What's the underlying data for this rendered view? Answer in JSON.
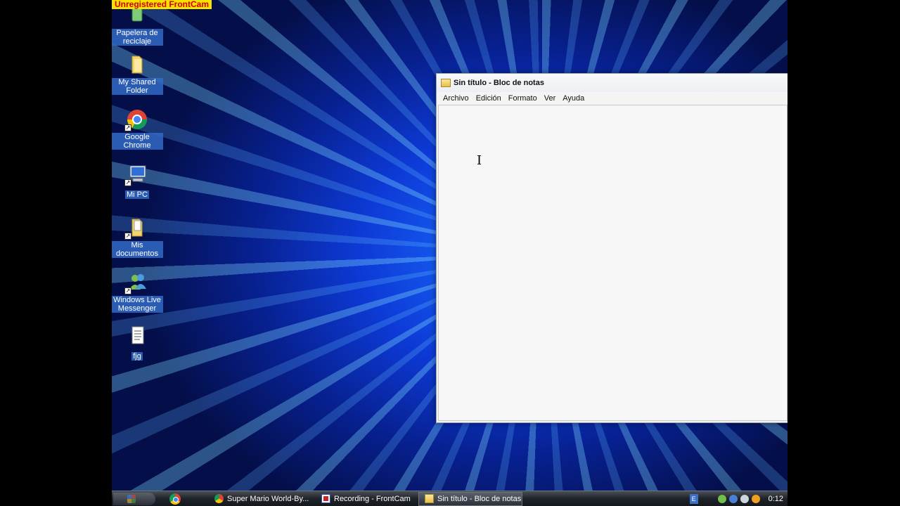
{
  "watermark": "Unregistered FrontCam",
  "desktop_icons": [
    {
      "label": "Papelera de reciclaje",
      "icon": "recycle-bin-icon"
    },
    {
      "label": "My Shared Folder",
      "icon": "folder-icon"
    },
    {
      "label": "Google Chrome",
      "icon": "chrome-icon"
    },
    {
      "label": "Mi PC",
      "icon": "computer-icon"
    },
    {
      "label": "Mis documentos",
      "icon": "documents-folder-icon"
    },
    {
      "label": "Windows Live Messenger",
      "icon": "messenger-icon"
    },
    {
      "label": "fjg",
      "icon": "text-file-icon"
    }
  ],
  "notepad": {
    "title": "Sin título - Bloc de notas",
    "menu": [
      "Archivo",
      "Edición",
      "Formato",
      "Ver",
      "Ayuda"
    ],
    "content": ""
  },
  "taskbar": {
    "items": [
      {
        "label": "Super Mario World-By...",
        "icon": "chrome-icon"
      },
      {
        "label": "Recording - FrontCam",
        "icon": "frontcam-icon"
      },
      {
        "label": "Sin título - Bloc de notas",
        "icon": "notepad-icon",
        "active": true
      }
    ],
    "language": "E",
    "clock": "0:12"
  }
}
